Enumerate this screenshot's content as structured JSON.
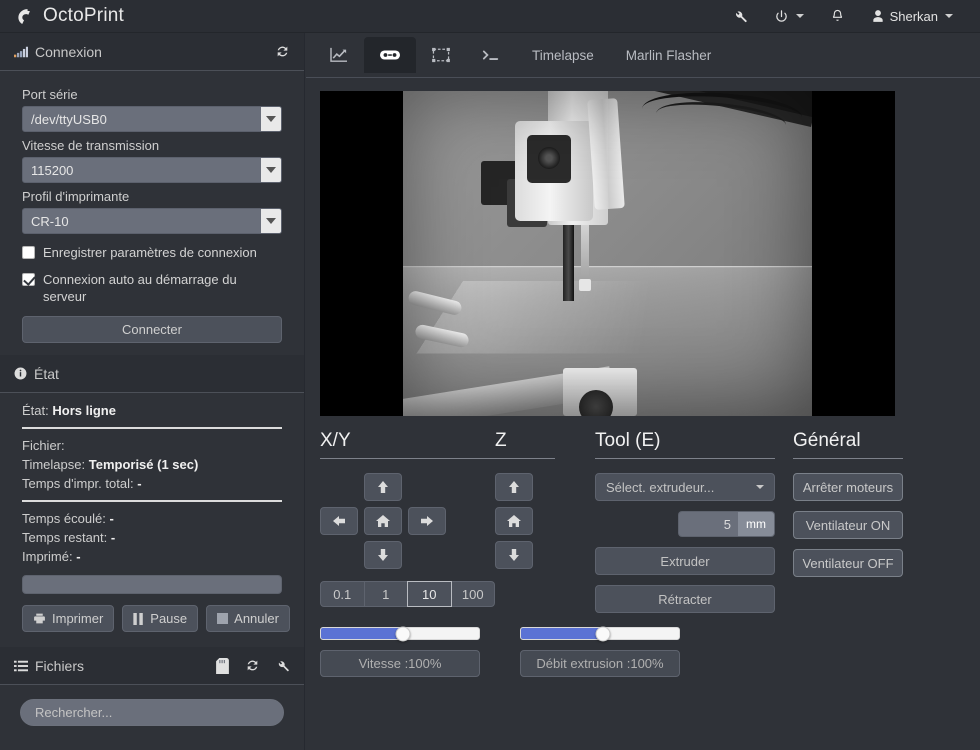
{
  "app": {
    "brand": "OctoPrint"
  },
  "navbar": {
    "items": [
      {
        "name": "wrench",
        "label": ""
      },
      {
        "name": "power",
        "label": ""
      },
      {
        "name": "bell",
        "label": ""
      }
    ],
    "user": "Sherkan"
  },
  "sidebar": {
    "connection": {
      "title": "Connexion",
      "port_label": "Port série",
      "port_value": "/dev/ttyUSB0",
      "baud_label": "Vitesse de transmission",
      "baud_value": "115200",
      "profile_label": "Profil d'imprimante",
      "profile_value": "CR-10",
      "save_checkbox": "Enregistrer paramètres de connexion",
      "save_checked": false,
      "auto_checkbox": "Connexion auto au démarrage du serveur",
      "auto_checked": true,
      "connect_button": "Connecter"
    },
    "state": {
      "title": "État",
      "state_label": "État:",
      "state_value": "Hors ligne",
      "file_label": "Fichier:",
      "file_value": "",
      "timelapse_label": "Timelapse:",
      "timelapse_value": "Temporisé (1 sec)",
      "total_time_label": "Temps d'impr. total:",
      "total_time_value": "-",
      "elapsed_label": "Temps écoulé:",
      "elapsed_value": "-",
      "remaining_label": "Temps restant:",
      "remaining_value": "-",
      "printed_label": "Imprimé:",
      "printed_value": "-",
      "progress_percent": 0,
      "print_button": "Imprimer",
      "pause_button": "Pause",
      "cancel_button": "Annuler"
    },
    "files": {
      "title": "Fichiers",
      "search_placeholder": "Rechercher..."
    }
  },
  "main": {
    "tabs": [
      {
        "name": "tab-temperature",
        "label": "",
        "icon": "chart-line-icon",
        "active": false
      },
      {
        "name": "tab-control",
        "label": "",
        "icon": "gamepad-icon",
        "active": true
      },
      {
        "name": "tab-gcode-viewer",
        "label": "",
        "icon": "object-group-icon",
        "active": false
      },
      {
        "name": "tab-terminal",
        "label": "",
        "icon": "terminal-icon",
        "active": false
      },
      {
        "name": "tab-timelapse",
        "label": "Timelapse",
        "icon": "",
        "active": false
      },
      {
        "name": "tab-marlin-flasher",
        "label": "Marlin Flasher",
        "icon": "",
        "active": false
      }
    ],
    "webcam": {
      "alt": "webcam-stream-3d-printer"
    },
    "control": {
      "xy": {
        "heading": "X/Y",
        "up": "▲",
        "down": "▼",
        "left": "◄",
        "right": "►",
        "home": "⌂",
        "steps": [
          "0.1",
          "1",
          "10",
          "100"
        ],
        "active_step": "10"
      },
      "z": {
        "heading": "Z",
        "up": "▲",
        "down": "▼",
        "home": "⌂"
      },
      "tool": {
        "heading": "Tool (E)",
        "extruder_select": "Sélect. extrudeur...",
        "amount_value": "5",
        "amount_unit": "mm",
        "extrude_button": "Extruder",
        "retract_button": "Rétracter"
      },
      "general": {
        "heading": "Général",
        "motors_off": "Arrêter moteurs",
        "fan_on": "Ventilateur ON",
        "fan_off": "Ventilateur OFF"
      },
      "sliders": [
        {
          "name": "feedrate",
          "label": "Vitesse :100%",
          "value": 52,
          "color": "#5b72d4"
        },
        {
          "name": "flowrate",
          "label": "Débit extrusion :100%",
          "value": 52,
          "color": "#5b72d4"
        }
      ]
    }
  },
  "colors": {
    "accent_blue": "#5b72d4",
    "bg_dark": "#2f3238",
    "panel": "#2b2e34",
    "button": "#4c515b"
  }
}
